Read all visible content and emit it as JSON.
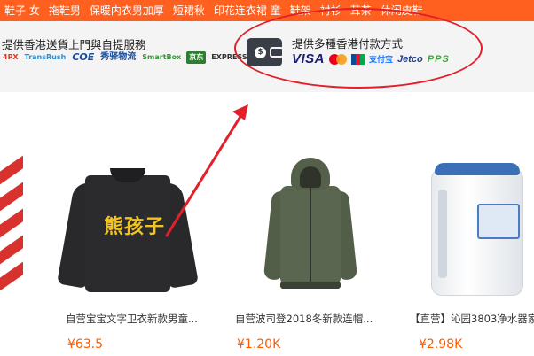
{
  "category_bar": {
    "items": [
      "鞋子 女",
      "拖鞋男",
      "保暖内衣男加厚",
      "短裙秋",
      "印花连衣裙 童",
      "鞋架",
      "衬衫",
      "茸茶",
      "休闲皮鞋"
    ]
  },
  "banner": {
    "delivery_title": "提供香港送貨上門與自提服務",
    "delivery_logos": [
      "4PX",
      "TransRush",
      "COE",
      "秀驿物流",
      "SmartBox",
      "京东",
      "EXPRESS"
    ],
    "payment_title": "提供多種香港付款方式",
    "payment_logos": {
      "visa": "VISA",
      "alipay": "支付宝",
      "jetco": "Jetco",
      "pps": "PPS"
    }
  },
  "products": [
    {
      "name": "自营宝宝文字卫衣新款男童...",
      "price": "¥63.5",
      "print_text": "熊孩子"
    },
    {
      "name": "自营波司登2018冬新款连帽...",
      "price": "¥1.20K"
    },
    {
      "name": "【直营】沁园3803净水器家",
      "price": "¥2.98K"
    }
  ],
  "colors": {
    "category_bar": "#ff5f1f",
    "price": "#ff5a00",
    "annotation_red": "#e3202a"
  }
}
